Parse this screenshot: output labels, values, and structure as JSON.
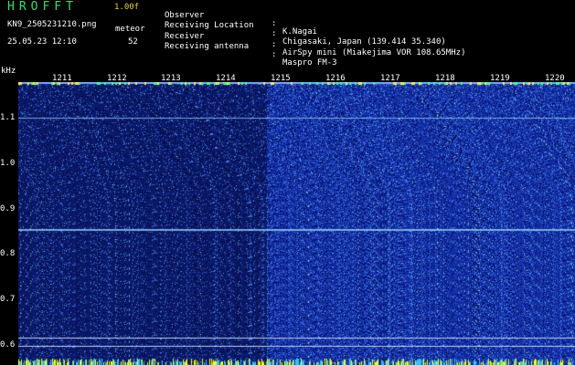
{
  "header": {
    "brand": "HROFFT",
    "version": "1.00f",
    "filename": "KN9_2505231210.png",
    "mode": "meteor",
    "datetime": "25.05.23 12:10",
    "count": "52"
  },
  "info": [
    {
      "label": "Observer",
      "value": "K.Nagai"
    },
    {
      "label": "Receiving Location",
      "value": "Chigasaki, Japan (139.414 35.340)"
    },
    {
      "label": "Receiver",
      "value": "AirSpy mini (Miakejima VOR 108.65MHz)"
    },
    {
      "label": "Receiving antenna",
      "value": "Maspro FM-3"
    }
  ],
  "colon": ":",
  "axis": {
    "unit": "kHz",
    "y_ticks": [
      "1.1",
      "1.0",
      "0.9",
      "0.8",
      "0.7",
      "0.6"
    ],
    "x_ticks": [
      "1211",
      "1212",
      "1213",
      "1214",
      "1215",
      "1216",
      "1217",
      "1218",
      "1219",
      "1220"
    ]
  },
  "colors": {
    "background": "#000000",
    "plot_dark": "#0c1a6e",
    "plot_bright": "#1430a8",
    "brand": "#33e066",
    "version": "#e8d040",
    "text": "#ffffff",
    "tick_mark": "#ffff00",
    "echo_line": "#9ad8ff"
  }
}
